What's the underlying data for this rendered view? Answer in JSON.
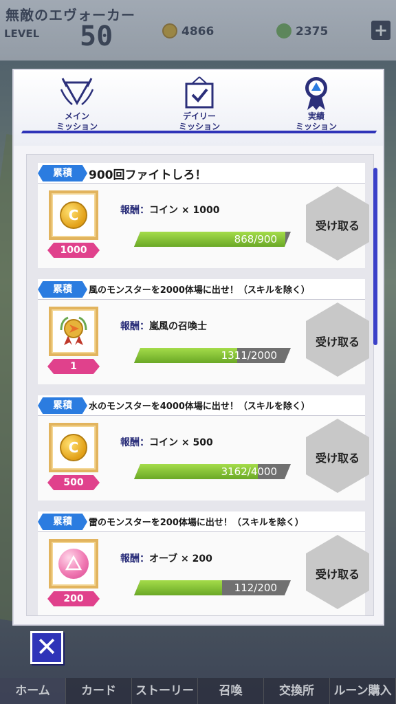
{
  "header": {
    "player_name": "無敵のエヴォーカー",
    "level_label": "LEVEL",
    "level_value": "50",
    "coins": "4866",
    "orbs": "2375",
    "plus": "+"
  },
  "mission_tabs": [
    {
      "label": "メイン\nミッション",
      "icon": "crest-icon"
    },
    {
      "label": "デイリー\nミッション",
      "icon": "calendar-check-icon"
    },
    {
      "label": "実績\nミッション",
      "icon": "medal-icon"
    }
  ],
  "missions": [
    {
      "badge": "累積",
      "title": "900回ファイトしろ！",
      "reward_key": "報酬",
      "reward_value": "コイン × 1000",
      "reward_icon": "coin-icon",
      "coin_letter": "C",
      "qty": "1000",
      "progress": 0.964,
      "progress_text": "868/900",
      "claim": "受け取る"
    },
    {
      "badge": "累積",
      "title": "風のモンスターを2000体場に出せ！（スキルを除く）",
      "reward_key": "報酬",
      "reward_value": "嵐風の召喚士",
      "reward_icon": "title-medal-icon",
      "qty": "1",
      "progress": 0.656,
      "progress_text": "1311/2000",
      "claim": "受け取る"
    },
    {
      "badge": "累積",
      "title": "水のモンスターを4000体場に出せ！（スキルを除く）",
      "reward_key": "報酬",
      "reward_value": "コイン × 500",
      "reward_icon": "coin-icon",
      "coin_letter": "C",
      "qty": "500",
      "progress": 0.79,
      "progress_text": "3162/4000",
      "claim": "受け取る"
    },
    {
      "badge": "累積",
      "title": "雷のモンスターを200体場に出せ！（スキルを除く）",
      "reward_key": "報酬",
      "reward_value": "オーブ × 200",
      "reward_icon": "orb-icon",
      "qty": "200",
      "progress": 0.56,
      "progress_text": "112/200",
      "claim": "受け取る"
    }
  ],
  "close_label": "✕",
  "bottom_tabs": [
    "ホーム",
    "カード",
    "ストーリー",
    "召喚",
    "交換所",
    "ルーン購入"
  ],
  "colors": {
    "accent": "#2f34b8",
    "badge": "#2b7ce0",
    "qty": "#e0418c",
    "progress": "#8cc63f"
  }
}
